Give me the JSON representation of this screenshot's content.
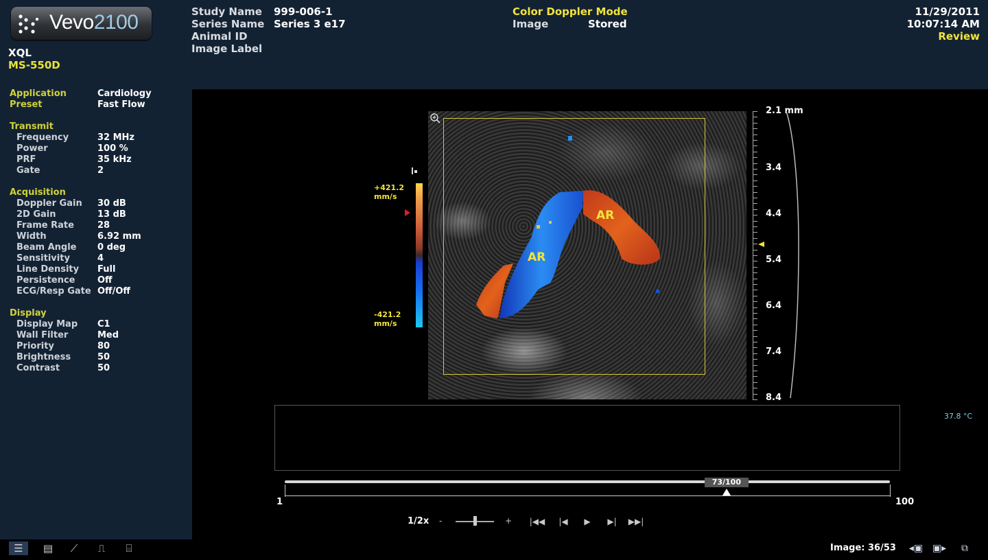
{
  "brand": {
    "name_prefix": "Vevo",
    "name_number": "2100"
  },
  "system": {
    "name": "XQL",
    "transducer": "MS-550D"
  },
  "header": {
    "study_name_label": "Study Name",
    "study_name": "999-006-1",
    "series_name_label": "Series Name",
    "series_name": "Series 3 e17",
    "animal_id_label": "Animal ID",
    "image_label_label": "Image Label",
    "mode": "Color Doppler Mode",
    "image_label": "Image",
    "image_status": "Stored",
    "date": "11/29/2011",
    "time": "10:07:14 AM",
    "view_mode": "Review"
  },
  "params": {
    "application_label": "Application",
    "application": "Cardiology",
    "preset_label": "Preset",
    "preset": "Fast Flow",
    "transmit_label": "Transmit",
    "frequency_label": "Frequency",
    "frequency": "32 MHz",
    "power_label": "Power",
    "power": "100 %",
    "prf_label": "PRF",
    "prf": "35 kHz",
    "gate_label": "Gate",
    "gate": "2",
    "acquisition_label": "Acquisition",
    "doppler_gain_label": "Doppler Gain",
    "doppler_gain": "30 dB",
    "gain_2d_label": "2D Gain",
    "gain_2d": "13 dB",
    "frame_rate_label": "Frame Rate",
    "frame_rate": "28",
    "width_label": "Width",
    "width": "6.92 mm",
    "beam_angle_label": "Beam Angle",
    "beam_angle": "0 deg",
    "sensitivity_label": "Sensitivity",
    "sensitivity": "4",
    "line_density_label": "Line Density",
    "line_density": "Full",
    "persistence_label": "Persistence",
    "persistence": "Off",
    "ecg_label": "ECG/Resp Gate",
    "ecg": "Off/Off",
    "display_label": "Display",
    "display_map_label": "Display Map",
    "display_map": "C1",
    "wall_filter_label": "Wall Filter",
    "wall_filter": "Med",
    "priority_label": "Priority",
    "priority": "80",
    "brightness_label": "Brightness",
    "brightness": "50",
    "contrast_label": "Contrast",
    "contrast": "50"
  },
  "image": {
    "annotation_1": "AR",
    "annotation_2": "AR",
    "velocity_max": "+421.2",
    "velocity_min": "-421.2",
    "velocity_unit": "mm/s",
    "colors": {
      "flow_toward": "#d0501e",
      "flow_away": "#1a6cf0",
      "roi": "#d7c83a"
    }
  },
  "depth_scale": {
    "labels": [
      "2.1 mm",
      "3.4",
      "4.4",
      "5.4",
      "6.4",
      "7.4",
      "8.4"
    ]
  },
  "temperature": "37.8 °C",
  "timeline": {
    "frame_badge": "73/100",
    "start": "1",
    "end": "100",
    "position_fraction": 0.73
  },
  "playback": {
    "speed": "1/2x",
    "minus": "-",
    "plus": "+",
    "icons": [
      "skip-to-start-icon",
      "step-back-icon",
      "play-icon",
      "step-forward-icon",
      "skip-to-end-icon"
    ]
  },
  "footer": {
    "image_count": "Image: 36/53"
  }
}
